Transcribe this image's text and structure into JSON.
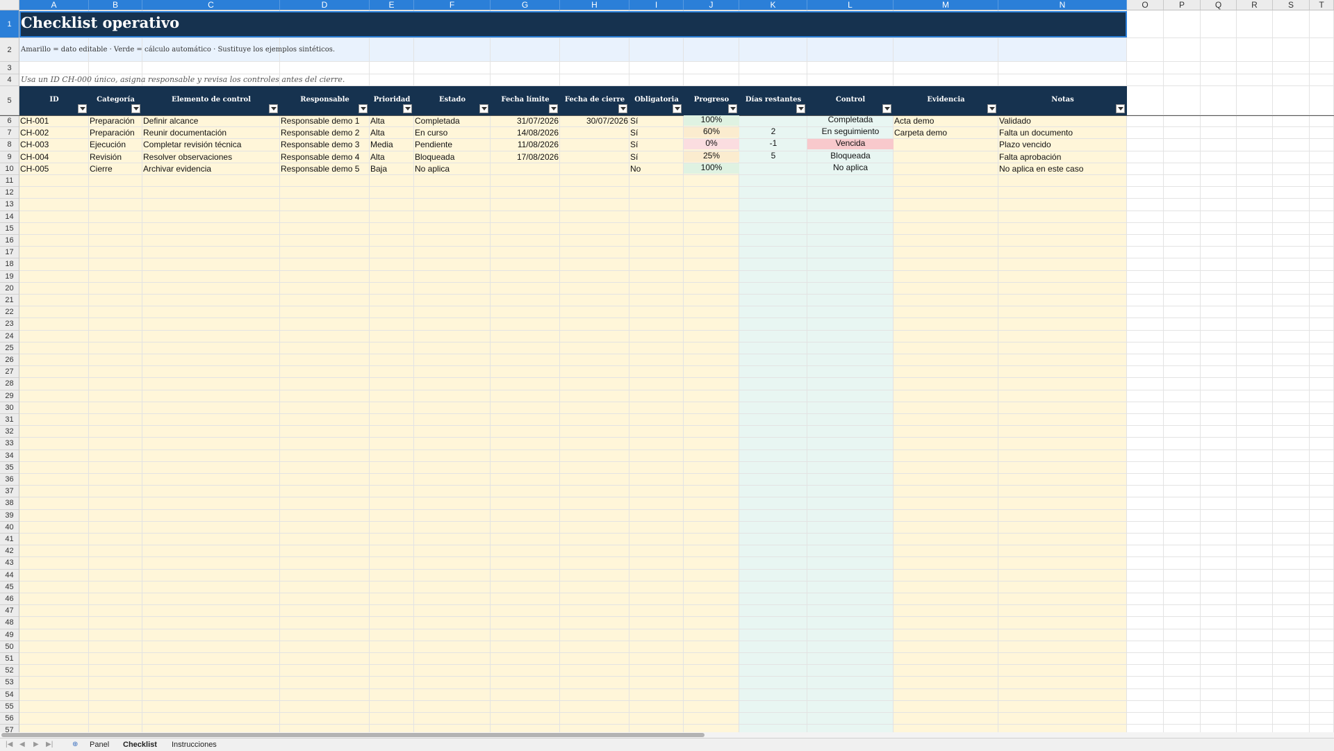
{
  "sheet": {
    "columns": [
      "A",
      "B",
      "C",
      "D",
      "E",
      "F",
      "G",
      "H",
      "I",
      "J",
      "K",
      "L",
      "M",
      "N",
      "O",
      "P",
      "Q",
      "R",
      "S",
      "T"
    ],
    "title": "Checklist operativo",
    "legend": "Amarillo = dato editable · Verde = cálculo automático · Sustituye los ejemplos sintéticos.",
    "instruction": "Usa un ID CH-000 único, asigna responsable y revisa los controles antes del cierre.",
    "headers": [
      "ID",
      "Categoría",
      "Elemento de control",
      "Responsable",
      "Prioridad",
      "Estado",
      "Fecha límite",
      "Fecha de cierre",
      "Obligatoria",
      "Progreso",
      "Días restantes",
      "Control",
      "Evidencia",
      "Notas"
    ],
    "rows": [
      {
        "id": "CH-001",
        "categoria": "Preparación",
        "elemento": "Definir alcance",
        "responsable": "Responsable demo 1",
        "prioridad": "Alta",
        "estado": "Completada",
        "fecha_limite": "31/07/2026",
        "fecha_cierre": "30/07/2026",
        "obligatoria": "Sí",
        "progreso": "100%",
        "dias": "",
        "control": "Completada",
        "evidencia": "Acta demo",
        "notas": "Validado"
      },
      {
        "id": "CH-002",
        "categoria": "Preparación",
        "elemento": "Reunir documentación",
        "responsable": "Responsable demo 2",
        "prioridad": "Alta",
        "estado": "En curso",
        "fecha_limite": "14/08/2026",
        "fecha_cierre": "",
        "obligatoria": "Sí",
        "progreso": "60%",
        "dias": "2",
        "control": "En seguimiento",
        "evidencia": "Carpeta demo",
        "notas": "Falta un documento"
      },
      {
        "id": "CH-003",
        "categoria": "Ejecución",
        "elemento": "Completar revisión técnica",
        "responsable": "Responsable demo 3",
        "prioridad": "Media",
        "estado": "Pendiente",
        "fecha_limite": "11/08/2026",
        "fecha_cierre": "",
        "obligatoria": "Sí",
        "progreso": "0%",
        "dias": "-1",
        "control": "Vencida",
        "evidencia": "",
        "notas": "Plazo vencido"
      },
      {
        "id": "CH-004",
        "categoria": "Revisión",
        "elemento": "Resolver observaciones",
        "responsable": "Responsable demo 4",
        "prioridad": "Alta",
        "estado": "Bloqueada",
        "fecha_limite": "17/08/2026",
        "fecha_cierre": "",
        "obligatoria": "Sí",
        "progreso": "25%",
        "dias": "5",
        "control": "Bloqueada",
        "evidencia": "",
        "notas": "Falta aprobación"
      },
      {
        "id": "CH-005",
        "categoria": "Cierre",
        "elemento": "Archivar evidencia",
        "responsable": "Responsable demo 5",
        "prioridad": "Baja",
        "estado": "No aplica",
        "fecha_limite": "",
        "fecha_cierre": "",
        "obligatoria": "No",
        "progreso": "100%",
        "dias": "",
        "control": "No aplica",
        "evidencia": "",
        "notas": "No aplica en este caso"
      }
    ]
  },
  "tabs": {
    "items": [
      "Panel",
      "Checklist",
      "Instrucciones"
    ],
    "active": "Checklist"
  },
  "colors": {
    "header_dark": "#16324f",
    "selection": "#2b7fd8",
    "editable_yellow": "#fff6d9",
    "auto_green": "#e8f6f2",
    "overdue_red": "#f8c9cc",
    "legend_blue": "#e9f2fd"
  }
}
